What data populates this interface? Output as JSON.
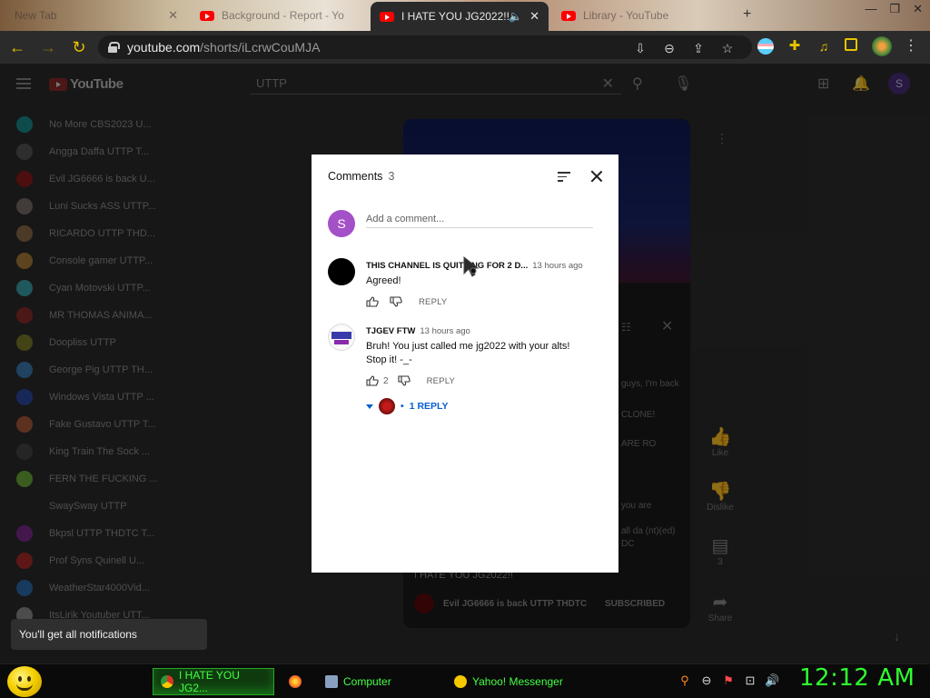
{
  "browser": {
    "tabs": [
      {
        "label": "New Tab",
        "active": false
      },
      {
        "label": "Background - Report - Yo",
        "active": false
      },
      {
        "label": "I HATE YOU JG2022!!",
        "active": true
      },
      {
        "label": "Library - YouTube",
        "active": false
      }
    ],
    "url_host": "youtube.com",
    "url_path": "/shorts/iLcrwCouMJA"
  },
  "youtube": {
    "logo_text": "YouTube",
    "search_value": "UTTP",
    "avatar_letter": "S",
    "sidebar": [
      {
        "label": "No More CBS2023 U...",
        "color": "#1a8a8a"
      },
      {
        "label": "Angga Daffa UTTP T...",
        "color": "#555"
      },
      {
        "label": "Evil JG6666 is back U...",
        "color": "#8a1a1a"
      },
      {
        "label": "Luni Sucks ASS UTTP...",
        "color": "#7a6a6a"
      },
      {
        "label": "RICARDO UTTP THD...",
        "color": "#8a6a4a"
      },
      {
        "label": "Console gamer UTTP...",
        "color": "#aa7a3a"
      },
      {
        "label": "Cyan Motovski UTTP...",
        "color": "#3aa0aa"
      },
      {
        "label": "MR THOMAS ANIMA...",
        "color": "#8a2a2a"
      },
      {
        "label": "Doopliss UTTP",
        "color": "#7a7a2a"
      },
      {
        "label": "George Pig UTTP TH...",
        "color": "#3a7ab0"
      },
      {
        "label": "Windows Vista UTTP ...",
        "color": "#2a4aa0"
      },
      {
        "label": "Fake Gustavo UTTP T...",
        "color": "#aa5a3a"
      },
      {
        "label": "King Train The Sock ...",
        "color": "#444"
      },
      {
        "label": "FERN THE FUCKING ...",
        "color": "#6aaa3a"
      },
      {
        "label": "SwaySway UTTP",
        "color": "#2a2a2a"
      },
      {
        "label": "Bkpsl UTTP THDTC T...",
        "color": "#7a2a8a"
      },
      {
        "label": "Prof Syns Quinell U...",
        "color": "#aa2a2a"
      },
      {
        "label": "WeatherStar4000Vid...",
        "color": "#2a6aaa"
      },
      {
        "label": "ItsLirik Youtuber UTT...",
        "color": "#8a8a8a"
      }
    ],
    "player": {
      "background_lines": [
        "guys, I'm back",
        "CLONE!",
        "ARE RO",
        "you are",
        "all da (nt)(ed)",
        "DC"
      ],
      "title": "I HATE YOU JG2022!!",
      "channel": "Evil JG6666 is back UTTP THDTC",
      "subscribe_label": "SUBSCRIBED",
      "actions": [
        {
          "icon": "like-icon",
          "label": "Like"
        },
        {
          "icon": "dislike-icon",
          "label": "Dislike"
        },
        {
          "icon": "comment-icon",
          "label": "3"
        },
        {
          "icon": "share-icon",
          "label": "Share"
        }
      ]
    }
  },
  "comments": {
    "title": "Comments",
    "count": "3",
    "me_initial": "S",
    "add_placeholder": "Add a comment...",
    "items": [
      {
        "author": "THIS CHANNEL IS QUITTING FOR 2 D...",
        "time": "13 hours ago",
        "text": "Agreed!",
        "likes": "",
        "reply_label": "REPLY",
        "avatar_color": "#000000"
      },
      {
        "author": "TJGEV FTW",
        "time": "13 hours ago",
        "text": "Bruh! You just called me jg2022 with your alts! Stop it! -_-",
        "likes": "2",
        "reply_label": "REPLY",
        "avatar_color": "#ffffff"
      }
    ],
    "replies_toggle": "1 REPLY"
  },
  "toast": "You'll get all notifications",
  "taskbar": {
    "items": [
      {
        "label": "I HATE YOU JG2...",
        "active": true,
        "color": "#dd3322"
      },
      {
        "label": "",
        "active": false,
        "color": "#ff7a1a"
      },
      {
        "label": "Computer",
        "active": false,
        "color": "#8aa0c0"
      },
      {
        "label": "Yahoo! Messenger",
        "active": false,
        "color": "#f5c800"
      }
    ],
    "clock": "12:12 AM"
  }
}
